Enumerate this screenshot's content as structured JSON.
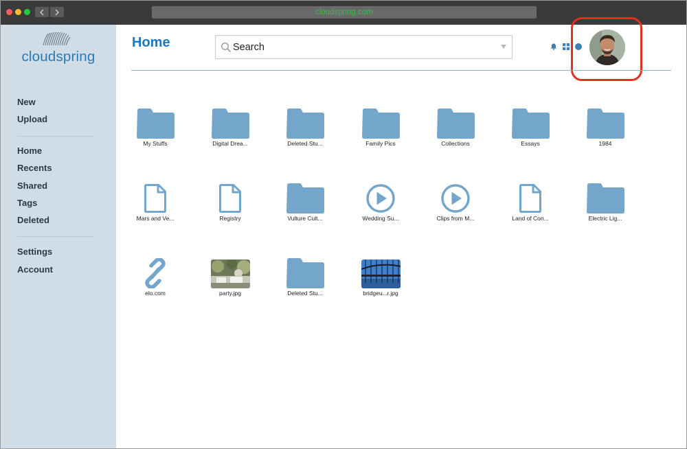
{
  "browser": {
    "url": "cloudspring.com",
    "traffic_lights": [
      "#ff5f57",
      "#febc2e",
      "#28c840"
    ]
  },
  "sidebar": {
    "logo_text": "cloudspring",
    "groups": [
      [
        "New",
        "Upload"
      ],
      [
        "Home",
        "Recents",
        "Shared",
        "Tags",
        "Deleted"
      ],
      [
        "Settings",
        "Account"
      ]
    ]
  },
  "header": {
    "title": "Home",
    "search_placeholder": "Search",
    "icons": [
      "bell-icon",
      "grid-view-icon",
      "info-icon"
    ]
  },
  "items": [
    {
      "label": "My Stuffs",
      "type": "folder"
    },
    {
      "label": "Digital Drea...",
      "type": "folder"
    },
    {
      "label": "Deleted Stu...",
      "type": "folder"
    },
    {
      "label": "Family Pics",
      "type": "folder"
    },
    {
      "label": "Collections",
      "type": "folder"
    },
    {
      "label": "Essays",
      "type": "folder"
    },
    {
      "label": "1984",
      "type": "folder"
    },
    {
      "label": "Mars and Ve...",
      "type": "file"
    },
    {
      "label": "Registry",
      "type": "file"
    },
    {
      "label": "Vulture Cult...",
      "type": "folder"
    },
    {
      "label": "Wedding Su...",
      "type": "video"
    },
    {
      "label": "Clips from M...",
      "type": "video"
    },
    {
      "label": "Land of Con...",
      "type": "file"
    },
    {
      "label": "Electric Lig...",
      "type": "folder"
    },
    {
      "label": "elo.com",
      "type": "link"
    },
    {
      "label": "party.jpg",
      "type": "image"
    },
    {
      "label": "Deleted Stu...",
      "type": "folder"
    },
    {
      "label": "bridgeu...r.jpg",
      "type": "image"
    }
  ],
  "colors": {
    "accent": "#1e78bf",
    "icon_fill": "#74a6cc",
    "sidebar_bg": "#d0dde7",
    "highlight_ring": "#e0301e"
  }
}
